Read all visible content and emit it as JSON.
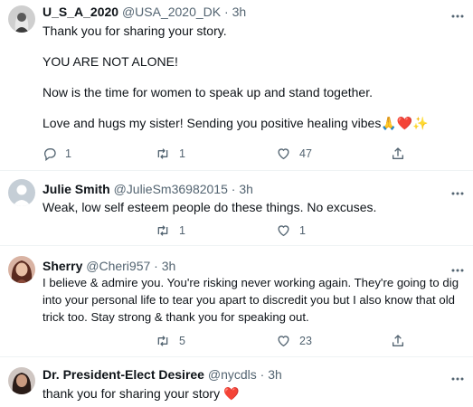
{
  "tweets": [
    {
      "name": "U_S_A_2020",
      "handle": "@USA_2020_DK",
      "separator": "·",
      "time": "3h",
      "lines": [
        "Thank you for sharing your story.",
        "YOU ARE NOT ALONE!",
        "Now is the time for women to speak up and stand together.",
        "Love and hugs my sister! Sending you positive healing vibes🙏❤️✨"
      ],
      "reply_count": "1",
      "retweet_count": "1",
      "like_count": "47"
    },
    {
      "name": "Julie Smith",
      "handle": "@JulieSm36982015",
      "separator": "·",
      "time": "3h",
      "lines": [
        "Weak, low self esteem people do these things.  No excuses."
      ],
      "reply_count": "",
      "retweet_count": "1",
      "like_count": "1"
    },
    {
      "name": "Sherry",
      "handle": "@Cheri957",
      "separator": "·",
      "time": "3h",
      "lines": [
        "I believe & admire you. You're risking never working again. They're going to dig into your personal life to tear you apart to discredit you but I also know that old trick too. Stay strong & thank you for speaking out."
      ],
      "reply_count": "",
      "retweet_count": "5",
      "like_count": "23"
    },
    {
      "name": "Dr. President-Elect Desiree",
      "handle": "@nycdls",
      "separator": "·",
      "time": "3h",
      "lines": [
        "thank you for sharing your story ❤️"
      ]
    }
  ],
  "colors": {
    "text": "#0f1419",
    "muted": "#536471",
    "divider": "#eff3f4",
    "heart": "#e0245e"
  },
  "icons": [
    "reply-icon",
    "retweet-icon",
    "like-icon",
    "share-icon",
    "more-options-icon"
  ]
}
